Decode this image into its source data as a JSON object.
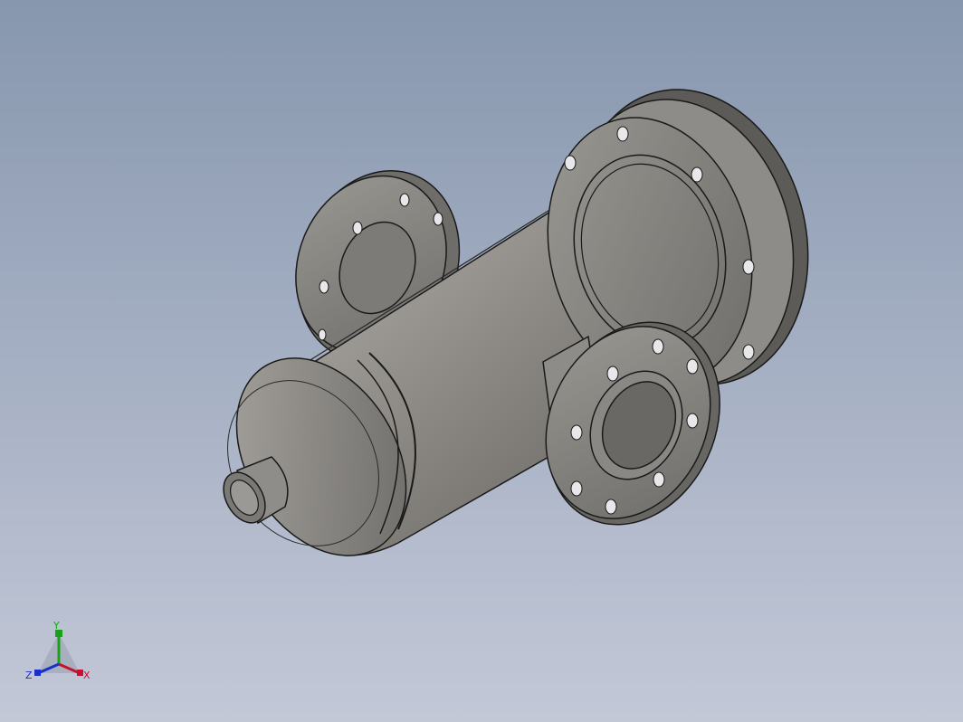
{
  "scene": {
    "background_top": "#8797ae",
    "background_bottom": "#c3c8d7",
    "part_color": "#8c8a86",
    "edge_color": "#1a1a1a"
  },
  "triad": {
    "x_label": "X",
    "y_label": "Y",
    "z_label": "Z",
    "x_color": "#c8102e",
    "y_color": "#1aa11a",
    "z_color": "#1a2fc8"
  }
}
